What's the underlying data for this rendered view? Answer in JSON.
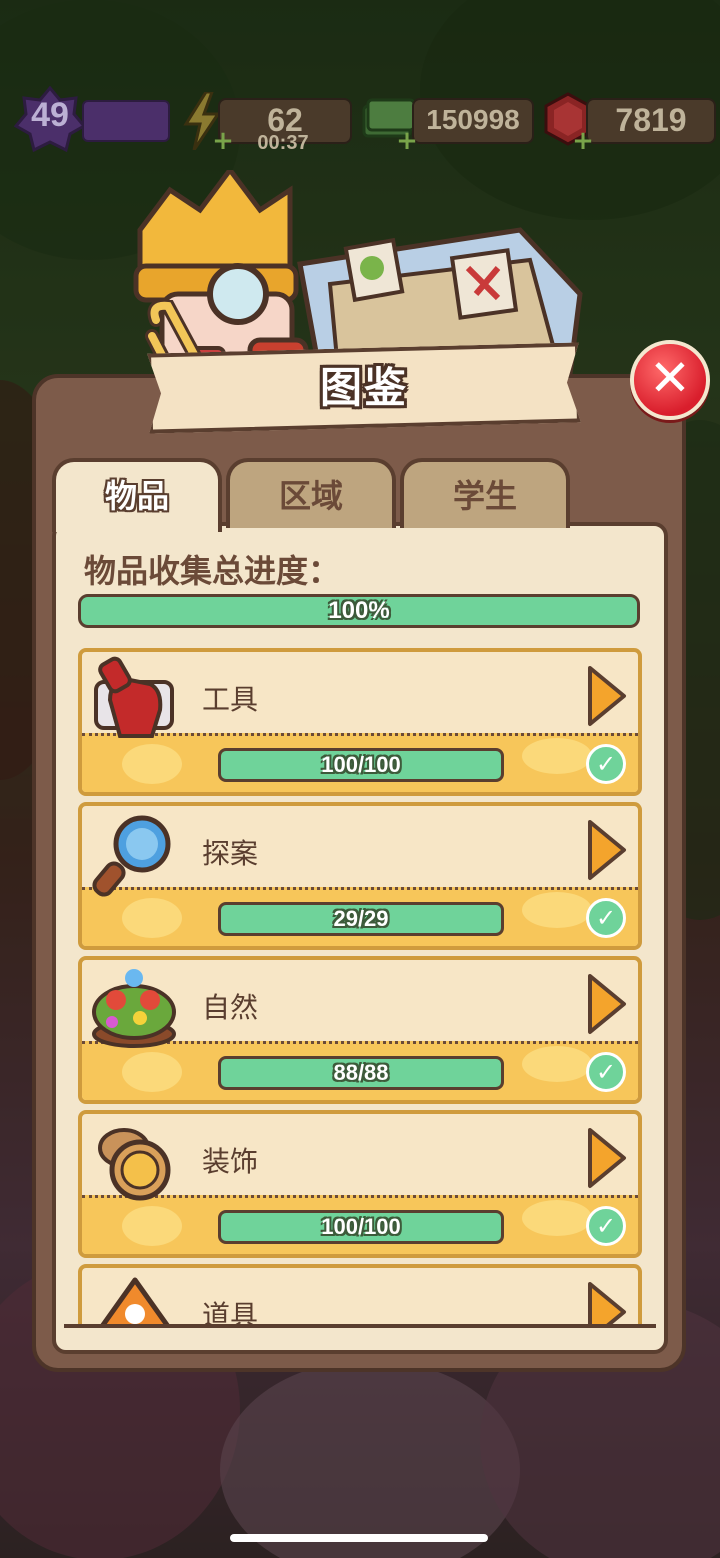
{
  "hud": {
    "level": "49",
    "energy": "62",
    "energy_timer": "00:37",
    "cash": "150998",
    "gems": "7819"
  },
  "dialog": {
    "title": "图鉴",
    "tabs": [
      {
        "label": "物品",
        "active": true
      },
      {
        "label": "区域",
        "active": false
      },
      {
        "label": "学生",
        "active": false
      }
    ],
    "progress_label": "物品收集总进度：",
    "progress_text": "100%",
    "progress_value": 1.0
  },
  "categories": [
    {
      "name": "工具",
      "progress": "100/100",
      "completed": true,
      "icon": "red-toolbox-icon"
    },
    {
      "name": "探案",
      "progress": "29/29",
      "completed": true,
      "icon": "magnifying-glass-icon"
    },
    {
      "name": "自然",
      "progress": "88/88",
      "completed": true,
      "icon": "flower-bush-icon"
    },
    {
      "name": "装饰",
      "progress": "100/100",
      "completed": true,
      "icon": "pocket-watch-icon"
    },
    {
      "name": "道具",
      "progress": "",
      "completed": false,
      "icon": "orange-sign-icon"
    }
  ],
  "colors": {
    "accent_green": "#6fd39a",
    "close_red": "#d91e2c",
    "panel_brown": "#7d5b4a",
    "card_gold": "#f7c65a"
  }
}
